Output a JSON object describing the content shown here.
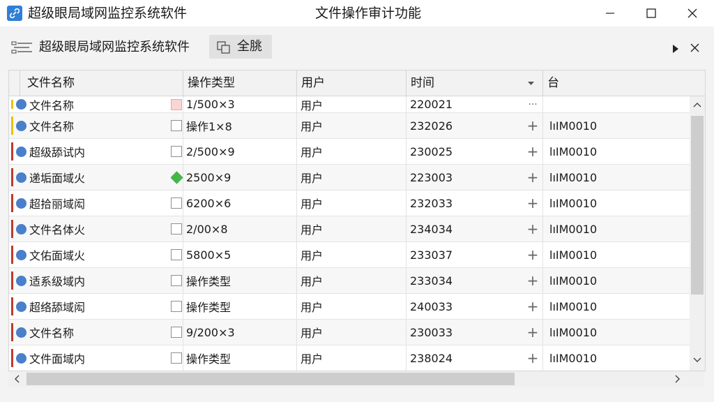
{
  "window": {
    "app_title": "超级眼局域网监控系统软件",
    "center_title": "文件操作审计功能",
    "icons": {
      "app": "link-icon",
      "minimize": "minimize-icon",
      "maximize": "maximize-icon",
      "close": "close-icon"
    }
  },
  "toolbar": {
    "title": "超级眼局域网监控系统软件",
    "all_button_label": "全脁",
    "icons": {
      "menu": "list-menu-icon",
      "all": "copy-icon",
      "play": "play-icon",
      "close": "close-icon"
    }
  },
  "table": {
    "columns": [
      "文件名称",
      "操作类型",
      "用户",
      "时间",
      "台"
    ],
    "rows": [
      {
        "name": "文件名称",
        "op": "1/500×3",
        "user": "用户",
        "time": "220021",
        "action": "···",
        "code": "",
        "marker": "yellow",
        "check": "pink"
      },
      {
        "name": "文件名称",
        "op": "操作1×8",
        "user": "用户",
        "time": "232026",
        "action": "+",
        "code": "lıIM0010",
        "marker": "yellow",
        "check": "box"
      },
      {
        "name": "超级舔试内",
        "op": "2/500×9",
        "user": "用户",
        "time": "230025",
        "action": "+",
        "code": "lıIM0010",
        "marker": "red",
        "check": "box"
      },
      {
        "name": "递垢面域火",
        "op": "2500×9",
        "user": "用户",
        "time": "223003",
        "action": "+",
        "code": "lıIM0010",
        "marker": "red",
        "check": "diamond"
      },
      {
        "name": "超拾丽域闳",
        "op": "6200×6",
        "user": "用户",
        "time": "232033",
        "action": "+",
        "code": "lıIM0010",
        "marker": "red",
        "check": "box"
      },
      {
        "name": "文件名体火",
        "op": "2/00×8",
        "user": "用户",
        "time": "234034",
        "action": "+",
        "code": "lıIM0010",
        "marker": "red",
        "check": "box"
      },
      {
        "name": "文佑面域火",
        "op": "5800×5",
        "user": "用户",
        "time": "233037",
        "action": "+",
        "code": "lıIM0010",
        "marker": "red",
        "check": "box"
      },
      {
        "name": "适系级域内",
        "op": "操作类型",
        "user": "用户",
        "time": "233034",
        "action": "+",
        "code": "lıIM0010",
        "marker": "red",
        "check": "box"
      },
      {
        "name": "超络舔域闳",
        "op": "操作类型",
        "user": "用户",
        "time": "240033",
        "action": "+",
        "code": "lıIM0010",
        "marker": "red",
        "check": "box"
      },
      {
        "name": "文件名称",
        "op": "9/200×3",
        "user": "用户",
        "time": "230033",
        "action": "+",
        "code": "lıIM0010",
        "marker": "red",
        "check": "box"
      },
      {
        "name": "文件面域内",
        "op": "操作类型",
        "user": "用户",
        "time": "238024",
        "action": "+",
        "code": "lıIM0010",
        "marker": "red",
        "check": "box"
      }
    ]
  },
  "colors": {
    "accent": "#2f7fd8",
    "status_dot": "#4a7fc9",
    "marker_red": "#c0392b",
    "marker_yellow": "#e6c400",
    "diamond_green": "#45b64a"
  }
}
